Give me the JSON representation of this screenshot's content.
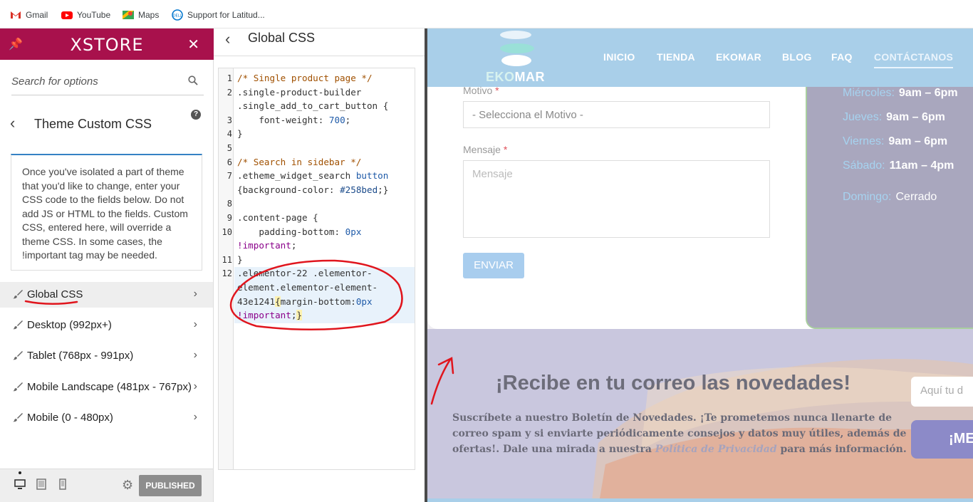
{
  "bookmarks": [
    {
      "label": "Gmail"
    },
    {
      "label": "YouTube"
    },
    {
      "label": "Maps"
    },
    {
      "label": "Support for Latitud..."
    }
  ],
  "customizer": {
    "logo": "XSTORE",
    "search_placeholder": "Search for options",
    "section_title": "Theme Custom CSS",
    "help": "?",
    "description": "Once you've isolated a part of theme that you'd like to change, enter your CSS code to the fields below. Do not add JS or HTML to the fields. Custom CSS, entered here, will override a theme CSS. In some cases, the !important tag may be needed.",
    "items": [
      {
        "label": "Global CSS"
      },
      {
        "label": "Desktop (992px+)"
      },
      {
        "label": "Tablet (768px - 991px)"
      },
      {
        "label": "Mobile Landscape (481px - 767px)"
      },
      {
        "label": "Mobile (0 - 480px)"
      }
    ],
    "publish_label": "PUBLISHED"
  },
  "editor": {
    "title": "Global CSS",
    "line_numbers": [
      "1",
      "2",
      "3",
      "4",
      "5",
      "6",
      "7",
      "8",
      "9",
      "10",
      "11",
      "12"
    ],
    "lines": {
      "l1": "/* Single product page */",
      "l2a": ".single-product-builder",
      "l2b": ".single_add_to_cart_button {",
      "l3": "font-weight",
      "l3v": "700",
      "l4": "}",
      "l6": "/* Search in sidebar */",
      "l7a": ".etheme_widget_search",
      "l7b": "button",
      "l7c": "{background-color:",
      "l7d": "#258bed",
      "l9": ".content-page {",
      "l10": "padding-bottom:",
      "l10v": "0px",
      "l10i": "!important",
      "l11": "}",
      "l12a": ".elementor-22 .elementor-",
      "l12b": "element.elementor-element-",
      "l12c": "43e1241",
      "l12d": "margin-bottom:",
      "l12e": "0px",
      "l12f": "!important"
    }
  },
  "preview": {
    "nav": [
      "INICIO",
      "TIENDA",
      "EKOMAR",
      "BLOG",
      "FAQ",
      "CONTÁCTANOS"
    ],
    "brand_a": "EKO",
    "brand_b": "MAR",
    "form": {
      "motivo_label": "Motivo",
      "required": "*",
      "motivo_value": "- Selecciona el Motivo -",
      "mensaje_label": "Mensaje",
      "mensaje_placeholder": "Mensaje",
      "send": "ENVIAR"
    },
    "hours": [
      {
        "day": "Miércoles:",
        "time": "9am – 6pm"
      },
      {
        "day": "Jueves:",
        "time": "9am – 6pm"
      },
      {
        "day": "Viernes:",
        "time": "9am – 6pm"
      },
      {
        "day": "Sábado:",
        "time": "11am – 4pm"
      },
      {
        "day": "Domingo:",
        "time": "Cerrado"
      }
    ],
    "newsletter": {
      "title": "¡Recibe en tu correo las novedades!",
      "text_a": "Suscríbete a nuestro Boletín de Novedades. ¡Te prometemos nunca llenarte de correo spam y si enviarte periódicamente consejos y datos muy útiles, además de ofertas!. Dale una mirada a nuestra",
      "link": "Política de Privacidad",
      "text_b": "para más información.",
      "email_placeholder": "Aquí tu d",
      "button": "¡ME"
    }
  },
  "colors": {
    "brand": "#a8114c",
    "accent": "#258bed",
    "annotation": "#e0151d"
  }
}
